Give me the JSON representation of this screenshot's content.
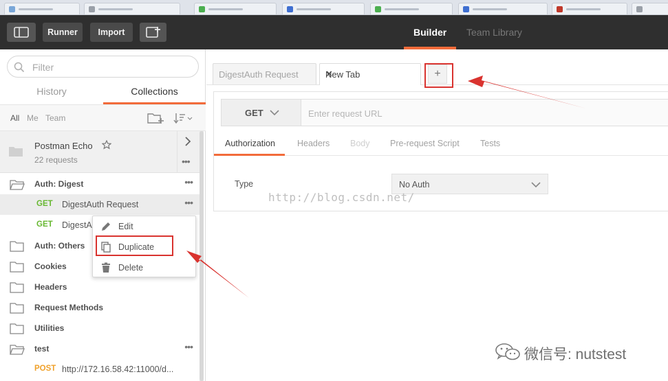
{
  "header": {
    "runner_label": "Runner",
    "import_label": "Import",
    "nav_tabs": [
      {
        "label": "Builder",
        "active": true
      },
      {
        "label": "Team Library",
        "active": false
      }
    ]
  },
  "sidebar": {
    "filter_placeholder": "Filter",
    "tabs": [
      {
        "label": "History",
        "active": false
      },
      {
        "label": "Collections",
        "active": true
      }
    ],
    "filters": [
      "All",
      "Me",
      "Team"
    ],
    "collection": {
      "name": "Postman Echo",
      "count": "22 requests"
    },
    "rows": [
      {
        "kind": "folder",
        "label": "Auth: Digest"
      },
      {
        "kind": "request",
        "method": "GET",
        "label": "DigestAuth Request"
      },
      {
        "kind": "request",
        "method": "GET",
        "label": "DigestA"
      },
      {
        "kind": "folder",
        "label": "Auth: Others"
      },
      {
        "kind": "folder",
        "label": "Cookies"
      },
      {
        "kind": "folder",
        "label": "Headers"
      },
      {
        "kind": "folder",
        "label": "Request Methods"
      },
      {
        "kind": "folder",
        "label": "Utilities"
      },
      {
        "kind": "folder",
        "label": "test"
      },
      {
        "kind": "request",
        "method": "POST",
        "label": "http://172.16.58.42:11000/d..."
      }
    ],
    "context_menu": [
      "Edit",
      "Duplicate",
      "Delete"
    ]
  },
  "request_tabs": [
    {
      "label": "DigestAuth Request",
      "active": false
    },
    {
      "label": "New Tab",
      "active": true
    }
  ],
  "builder": {
    "method": "GET",
    "url_placeholder": "Enter request URL",
    "sub_tabs": [
      "Authorization",
      "Headers",
      "Body",
      "Pre-request Script",
      "Tests"
    ],
    "auth_type_label": "Type",
    "auth_type_value": "No Auth"
  },
  "watermark": "http://blog.csdn.net/",
  "wechat_text": "微信号: nutstest",
  "colors": {
    "accent": "#f26b3a",
    "header_bg": "#2f2f2f",
    "get": "#68b832",
    "post": "#f0a12b",
    "annotation": "#d9332f"
  }
}
